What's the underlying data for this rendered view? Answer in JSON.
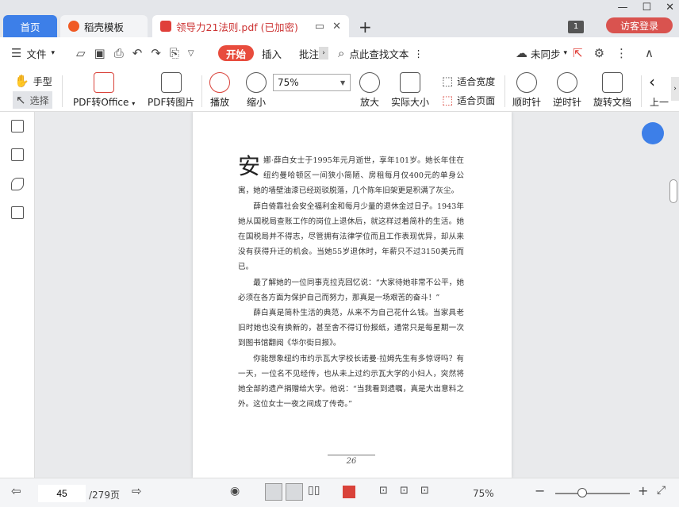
{
  "tabs": {
    "home": "首页",
    "template": "稻壳模板",
    "document": "领导力21法则.pdf (已加密)"
  },
  "window": {
    "page_badge": "1",
    "login": "访客登录"
  },
  "menubar": {
    "file": "文件",
    "start": "开始",
    "insert": "插入",
    "annotate": "批注",
    "search": "点此查找文本",
    "sync": "未同步"
  },
  "toolbar": {
    "hand": "手型",
    "select": "选择",
    "pdf_to_office": "PDF转Office",
    "pdf_to_image": "PDF转图片",
    "play": "播放",
    "zoom_out": "缩小",
    "zoom_value": "75%",
    "zoom_in": "放大",
    "actual_size": "实际大小",
    "fit_width": "适合宽度",
    "fit_page": "适合页面",
    "rotate_cw": "顺时针",
    "rotate_ccw": "逆时针",
    "rotate_doc": "旋转文档",
    "prev": "上一"
  },
  "document": {
    "dropcap": "安",
    "paragraphs": [
      "娜·薛白女士于1995年元月逝世，享年101岁。她长年住在纽约曼哈顿区一间狭小简陋、房租每月仅400元的单身公寓，她的墙壁油漆已经斑驳脱落，几个陈年旧架更是积满了灰尘。",
      "薛白倚靠社会安全福利金和每月少量的退休金过日子。1943年她从国税局查账工作的岗位上退休后，就这样过着简朴的生活。她在国税局并不得志，尽管拥有法律学位而且工作表现优异，却从来没有获得升迁的机会。当她55岁退休时，年薪只不过3150美元而已。",
      "最了解她的一位同事克拉克回忆说：“大家待她非常不公平，她必须在各方面为保护自己而努力，那真是一场艰苦的奋斗！”",
      "薛白真是简朴生活的典范，从来不为自己花什么钱。当家具老旧时她也没有换新的，甚至舍不得订份报纸，通常只是每星期一次到图书馆翻阅《华尔街日报》。",
      "你能想象纽约市约示瓦大学校长诺曼·拉姆先生有多惊讶吗？有一天，一位名不见经传，也从未上过约示瓦大学的小妇人，突然将她全部的遗产捐赠给大学。他说：“当我看到遗嘱，真是大出意料之外。这位女士一夜之间成了传奇。”"
    ],
    "page_footer": "26"
  },
  "statusbar": {
    "current_page": "45",
    "total_pages": "/279页",
    "zoom": "75%"
  }
}
